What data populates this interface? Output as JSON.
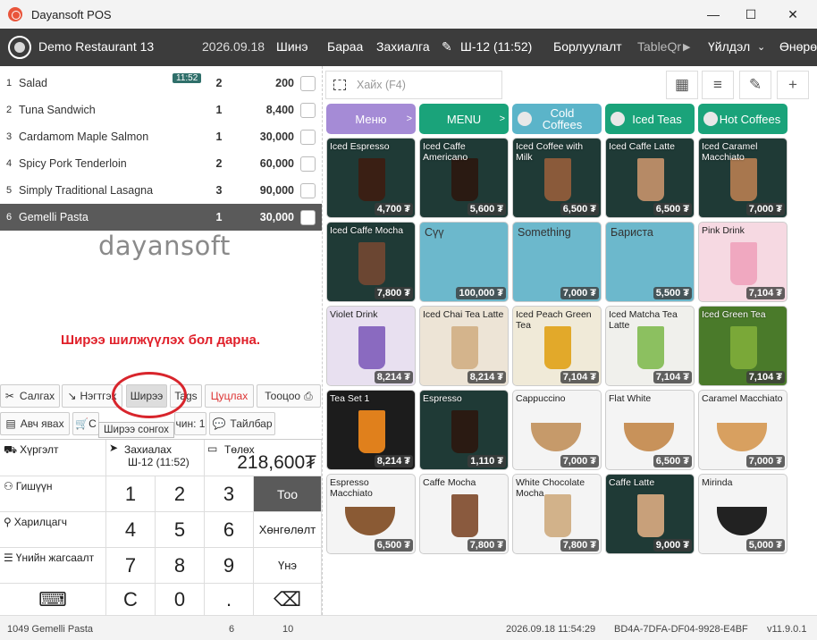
{
  "window": {
    "title": "Dayansoft POS",
    "minimize": "—",
    "maximize": "☐",
    "close": "✕"
  },
  "nav": {
    "restaurant": "Demo Restaurant 13",
    "date": "2026.09.18",
    "items": [
      "Шинэ",
      "Бараа",
      "Захиалга",
      "Ш-12 (11:52)",
      "Борлуулалт",
      "TableQr",
      "Үйлдэл",
      "Өнөрө"
    ]
  },
  "order": {
    "rows": [
      {
        "num": "1",
        "name": "Salad",
        "qty": "2",
        "price": "200",
        "badge": "11:52"
      },
      {
        "num": "2",
        "name": "Tuna Sandwich",
        "qty": "1",
        "price": "8,400"
      },
      {
        "num": "3",
        "name": "Cardamom Maple Salmon",
        "qty": "1",
        "price": "30,000"
      },
      {
        "num": "4",
        "name": "Spicy Pork Tenderloin",
        "qty": "2",
        "price": "60,000"
      },
      {
        "num": "5",
        "name": "Simply Traditional Lasagna",
        "qty": "3",
        "price": "90,000"
      },
      {
        "num": "6",
        "name": "Gemelli Pasta",
        "qty": "1",
        "price": "30,000"
      }
    ]
  },
  "brand": "dayansoft",
  "annotation": "Ширээ шилжүүлэх бол дарна.",
  "actions": {
    "split": "Салгах",
    "merge": "Нэгтгэх",
    "table": "Ширээ",
    "tags": "Tags",
    "cancel": "Цуцлах",
    "count": "Тооцоо",
    "takeaway": "Авч явах",
    "cart": "С",
    "guests": "чин: 1",
    "note": "Тайлбар",
    "tooltip": "Ширээ сонгох"
  },
  "keypad": {
    "delivery": "Хүргэлт",
    "order_label": "Захиалах",
    "order_value": "Ш-12 (11:52)",
    "pay_label": "Төлөх",
    "pay_value": "218,600₮",
    "member": "Гишүүн",
    "customer": "Харилцагч",
    "discount": "Үнийн жагсаалт",
    "digits": [
      "1",
      "2",
      "3",
      "4",
      "5",
      "6",
      "7",
      "8",
      "9",
      "C",
      "0",
      "."
    ],
    "qty": "Тоо",
    "discount_btn": "Хөнгөлөлт",
    "price_btn": "Үнэ"
  },
  "search": {
    "placeholder": "Хайх (F4)"
  },
  "categories": [
    {
      "label": "Меню",
      "color": "#a58bd6"
    },
    {
      "label": "MENU",
      "color": "#1aa37a"
    },
    {
      "label": "Cold Coffees",
      "color": "#5bb4c9"
    },
    {
      "label": "Iced Teas",
      "color": "#1aa37a"
    },
    {
      "label": "Hot Coffees",
      "color": "#1aa37a"
    }
  ],
  "products": [
    {
      "name": "Iced Espresso",
      "price": "4,700 ₮",
      "bg": "#1f3a36",
      "cup": "#3a1f14"
    },
    {
      "name": "Iced Caffe Americano",
      "price": "5,600 ₮",
      "bg": "#1f3a36",
      "cup": "#2a1a12"
    },
    {
      "name": "Iced Coffee with Milk",
      "price": "6,500 ₮",
      "bg": "#1f3a36",
      "cup": "#8a5a3a"
    },
    {
      "name": "Iced Caffe Latte",
      "price": "6,500 ₮",
      "bg": "#1f3a36",
      "cup": "#b68a66"
    },
    {
      "name": "Iced Caramel Macchiato",
      "price": "7,000 ₮",
      "bg": "#1f3a36",
      "cup": "#a8774e"
    },
    {
      "name": "Iced Caffe Mocha",
      "price": "7,800 ₮",
      "bg": "#1f3a36",
      "cup": "#6b4632"
    },
    {
      "name": "Сүү",
      "price": "100,000 ₮",
      "plain": "#6cb8cc"
    },
    {
      "name": "Something",
      "price": "7,000 ₮",
      "plain": "#6cb8cc"
    },
    {
      "name": "Бариста",
      "price": "5,500 ₮",
      "plain": "#6cb8cc"
    },
    {
      "name": "Pink Drink",
      "price": "7,104 ₮",
      "bg": "#f6d9e2",
      "cup": "#f0a8c0"
    },
    {
      "name": "Violet Drink",
      "price": "8,214 ₮",
      "bg": "#e8e0f0",
      "cup": "#8a6ac0"
    },
    {
      "name": "Iced Chai Tea Latte",
      "price": "8,214 ₮",
      "bg": "#ede4d6",
      "cup": "#d4b48c"
    },
    {
      "name": "Iced Peach Green Tea",
      "price": "7,104 ₮",
      "bg": "#f0ead8",
      "cup": "#e2a92a"
    },
    {
      "name": "Iced Matcha Tea Latte",
      "price": "7,104 ₮",
      "bg": "#f0f0ec",
      "cup": "#8cc060"
    },
    {
      "name": "Iced Green Tea",
      "price": "7,104 ₮",
      "bg": "#4a7a2a",
      "cup": "#7aa838"
    },
    {
      "name": "Tea Set 1",
      "price": "8,214 ₮",
      "bg": "#1c1c1c",
      "cup": "#e0801c"
    },
    {
      "name": "Espresso",
      "price": "1,110 ₮",
      "bg": "#1f3a36",
      "cup": "#2a1a12"
    },
    {
      "name": "Cappuccino",
      "price": "7,000 ₮",
      "bg": "#f4f4f4",
      "mug": "#c69a6a"
    },
    {
      "name": "Flat White",
      "price": "6,500 ₮",
      "bg": "#f4f4f4",
      "mug": "#c8925a"
    },
    {
      "name": "Caramel Macchiato",
      "price": "7,000 ₮",
      "bg": "#f4f4f4",
      "mug": "#d8a060"
    },
    {
      "name": "Espresso Macchiato",
      "price": "6,500 ₮",
      "bg": "#f4f4f4",
      "mug": "#8a5a34"
    },
    {
      "name": "Caffe Mocha",
      "price": "7,800 ₮",
      "bg": "#f4f4f4",
      "cup": "#8a5a3e"
    },
    {
      "name": "White Chocolate Mocha",
      "price": "7,800 ₮",
      "bg": "#f4f4f4",
      "cup": "#d2b28a"
    },
    {
      "name": "Caffe Latte",
      "price": "9,000 ₮",
      "bg": "#1f3a36",
      "cup": "#c8a07a"
    },
    {
      "name": "Mirinda",
      "price": "5,000 ₮",
      "bg": "#f4f4f4",
      "mug": "#222222"
    }
  ],
  "status": {
    "product": "1049 Gemelli Pasta",
    "n1": "6",
    "n2": "10",
    "datetime": "2026.09.18 11:54:29",
    "device": "BD4A-7DFA-DF04-9928-E4BF",
    "version": "v11.9.0.1"
  }
}
